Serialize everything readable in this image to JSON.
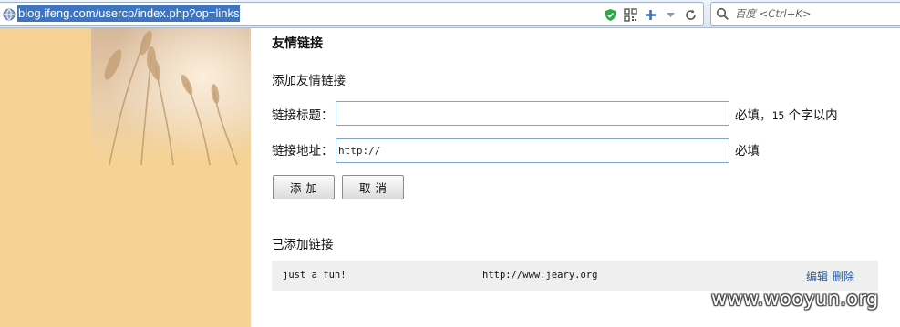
{
  "browser": {
    "url": "blog.ifeng.com/usercp/index.php?op=links",
    "search_placeholder": "百度 <Ctrl+K>",
    "icons": [
      "globe-icon",
      "shield-check-icon",
      "qr-code-icon",
      "plus-icon",
      "dropdown-arrow-icon",
      "refresh-icon",
      "search-icon"
    ],
    "accent_color": "#3b75c4"
  },
  "page": {
    "section_title": "友情链接",
    "add_title": "添加友情链接",
    "title_label": "链接标题：",
    "title_value": "",
    "title_hint_prefix": "必填，",
    "title_hint_number": "15",
    "title_hint_suffix": " 个字以内",
    "url_label": "链接地址：",
    "url_value": "http://",
    "url_hint": "必填",
    "add_button": "添加",
    "cancel_button": "取消",
    "added_title": "已添加链接",
    "links": [
      {
        "name": "just a fun!",
        "url": "http://www.jeary.org",
        "edit": "编辑",
        "delete": "删除"
      }
    ],
    "sidebar_color": "#f7d393"
  },
  "watermark": "www.wooyun.org"
}
